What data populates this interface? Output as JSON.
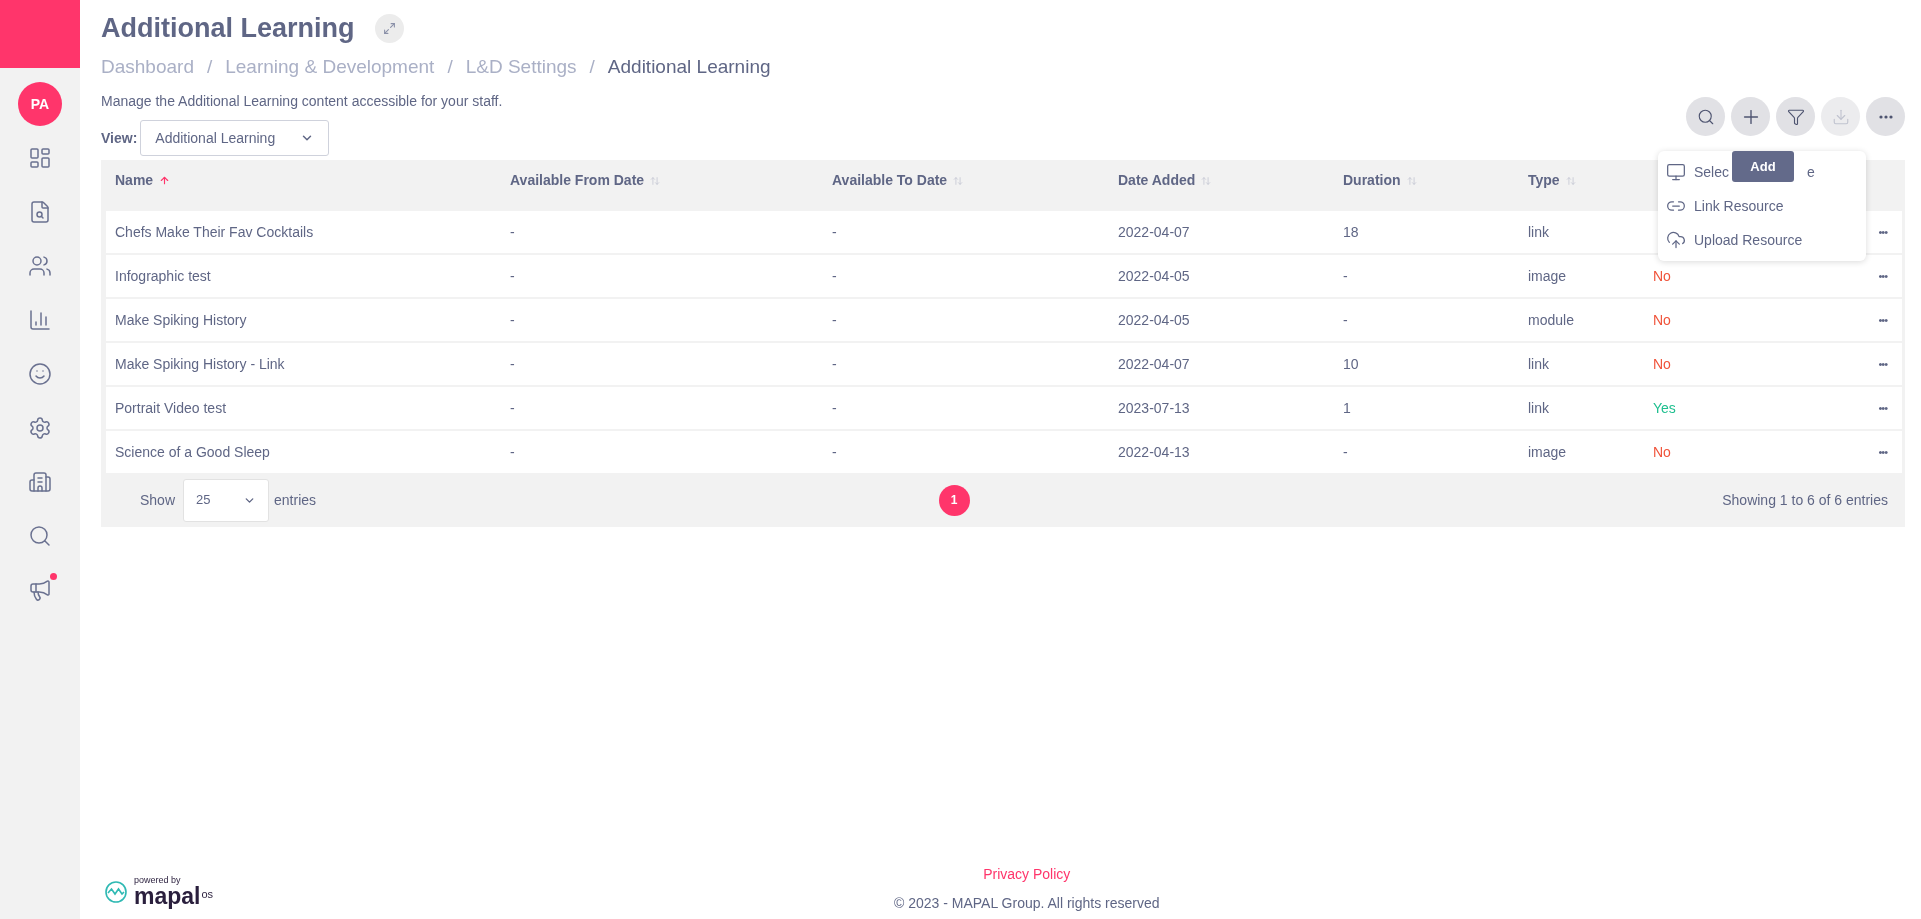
{
  "sidebar": {
    "avatar": "PA",
    "items": [
      {
        "kind": "dashboard",
        "selected": false
      },
      {
        "kind": "search-doc",
        "selected": false
      },
      {
        "kind": "people",
        "selected": false
      },
      {
        "kind": "chart",
        "selected": false
      },
      {
        "kind": "smile",
        "selected": false
      },
      {
        "kind": "settings",
        "selected": false
      },
      {
        "kind": "building",
        "selected": false
      },
      {
        "kind": "search",
        "selected": false
      },
      {
        "kind": "megaphone",
        "selected": false,
        "notification": true
      }
    ]
  },
  "page": {
    "title": "Additional Learning",
    "breadcrumbs": [
      {
        "label": "Dashboard",
        "current": false
      },
      {
        "label": "Learning & Development",
        "current": false
      },
      {
        "label": "L&D Settings",
        "current": false
      },
      {
        "label": "Additional Learning",
        "current": true
      }
    ],
    "breadcrumb_separator": "/",
    "description": "Manage the Additional Learning content accessible for your staff.",
    "view_label": "View:",
    "view_value": "Additional Learning"
  },
  "toolbar": [
    {
      "kind": "search",
      "disabled": false
    },
    {
      "kind": "add",
      "disabled": false
    },
    {
      "kind": "filter",
      "disabled": false
    },
    {
      "kind": "download",
      "disabled": true
    },
    {
      "kind": "more",
      "disabled": false
    }
  ],
  "tooltip": "Add",
  "add_menu": [
    {
      "kind": "monitor",
      "label_start": "Selec",
      "label_end": "e"
    },
    {
      "kind": "link",
      "label": "Link Resource"
    },
    {
      "kind": "upload",
      "label": "Upload Resource"
    }
  ],
  "table": {
    "columns": [
      {
        "label": "Name",
        "sorted": true
      },
      {
        "label": "Available From Date",
        "sorted": false
      },
      {
        "label": "Available To Date",
        "sorted": false
      },
      {
        "label": "Date Added",
        "sorted": false
      },
      {
        "label": "Duration",
        "sorted": false
      },
      {
        "label": "Type",
        "sorted": false
      }
    ],
    "rows": [
      {
        "cells": [
          "Chefs Make Their Fav Cocktails",
          "-",
          "-",
          "2022-04-07",
          "18",
          "link"
        ]
      },
      {
        "cells": [
          "Infographic test",
          "-",
          "-",
          "2022-04-05",
          "-",
          "image"
        ],
        "status": {
          "text": "No",
          "color": "#f0533a"
        }
      },
      {
        "cells": [
          "Make Spiking History",
          "-",
          "-",
          "2022-04-05",
          "-",
          "module"
        ],
        "status": {
          "text": "No",
          "color": "#f0533a"
        }
      },
      {
        "cells": [
          "Make Spiking History - Link",
          "-",
          "-",
          "2022-04-07",
          "10",
          "link"
        ],
        "status": {
          "text": "No",
          "color": "#f0533a"
        }
      },
      {
        "cells": [
          "Portrait Video test",
          "-",
          "-",
          "2023-07-13",
          "1",
          "link"
        ],
        "status": {
          "text": "Yes",
          "color": "#1fbf8f"
        }
      },
      {
        "cells": [
          "Science of a Good Sleep",
          "-",
          "-",
          "2022-04-13",
          "-",
          "image"
        ],
        "status": {
          "text": "No",
          "color": "#f0533a"
        }
      }
    ],
    "row_menu": "•••",
    "show_label": "Show",
    "page_size": "25",
    "entries_label": "entries",
    "pages": [
      {
        "label": "1",
        "selected": true
      }
    ],
    "summary": "Showing 1 to 6 of 6 entries"
  },
  "footer": {
    "powered_by": "powered by",
    "brand": "mapal",
    "brand_suffix": "os",
    "privacy": "Privacy Policy",
    "copyright": "© 2023 - MAPAL Group. All rights reserved"
  }
}
